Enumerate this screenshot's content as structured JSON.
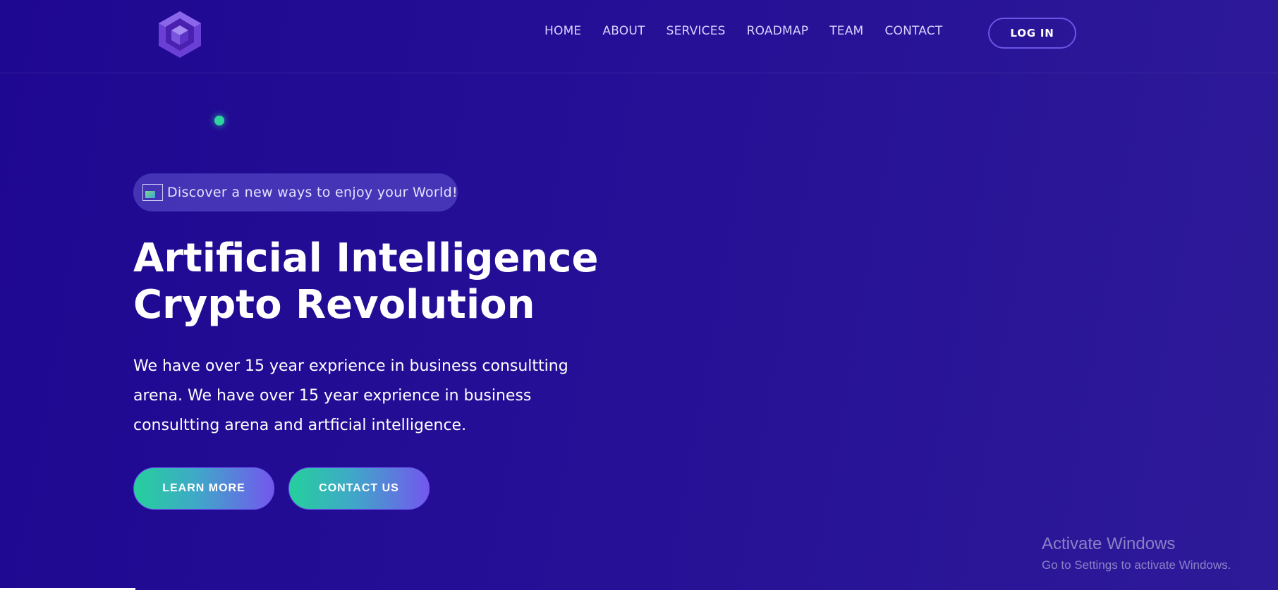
{
  "header": {
    "logo_icon": "hexagon-cube-icon",
    "nav": [
      "HOME",
      "ABOUT",
      "SERVICES",
      "ROADMAP",
      "TEAM",
      "CONTACT"
    ],
    "login_label": "LOG IN"
  },
  "hero": {
    "tagline": "Discover a new ways to enjoy your World!",
    "tagline_icon": "broken-image-icon",
    "title_line1": "Artificial Intelligence",
    "title_line2": "Crypto Revolution",
    "description": "We have over 15 year exprience in business consultting arena. We have over 15 year exprience in business consultting arena and artficial intelligence.",
    "learn_more_label": "LEARN MORE",
    "contact_us_label": "CONTACT US"
  },
  "watermark": {
    "title": "Activate Windows",
    "subtitle": "Go to Settings to activate Windows."
  },
  "colors": {
    "background": "#220d94",
    "accent_green": "#25d09c",
    "accent_purple": "#7357ee",
    "login_border": "#6d54e8"
  }
}
